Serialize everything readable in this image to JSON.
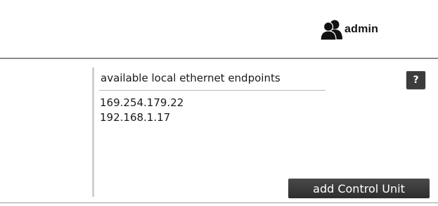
{
  "header": {
    "user_icon": "users-icon",
    "username": "admin"
  },
  "panel": {
    "list_title": "available local ethernet endpoints",
    "endpoints": [
      "169.254.179.22",
      "192.168.1.17"
    ],
    "help_label": "?",
    "help_icon": "help-icon",
    "add_button_label": "add Control Unit"
  },
  "colors": {
    "button_bg": "#3a3a3a",
    "divider": "#8a8a8a",
    "panel_rule": "#d0d0d0"
  }
}
